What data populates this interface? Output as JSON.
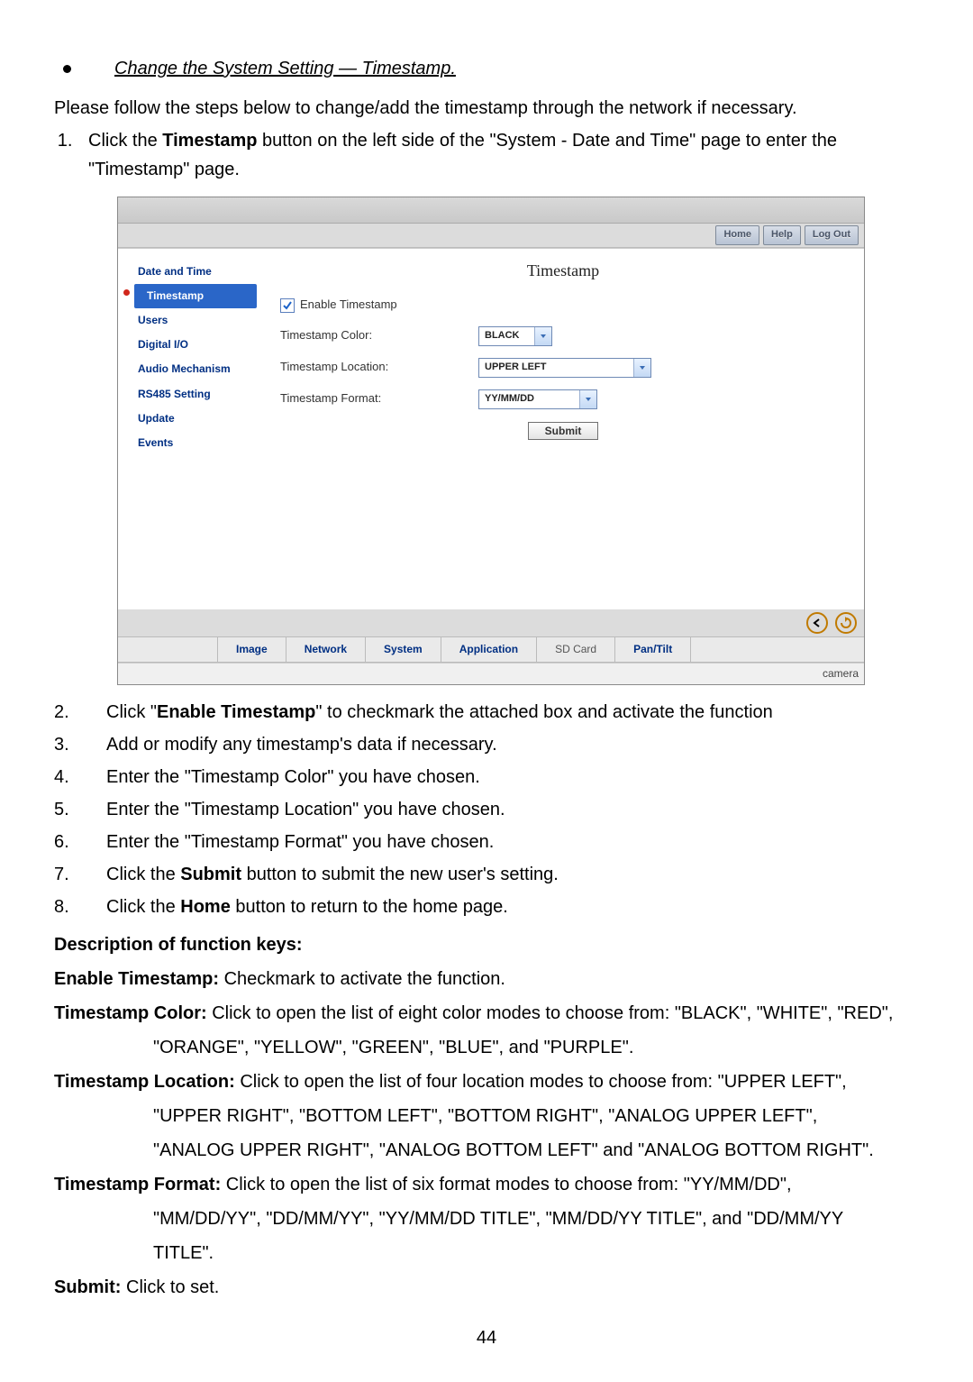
{
  "heading": "Change the System Setting — Timestamp.",
  "intro": "Please follow the steps below to change/add the timestamp through the network if necessary.",
  "step1_prefix": "Click the ",
  "step1_bold": "Timestamp",
  "step1_mid": " button on the left side of the \"System - Date and Time\" page to enter the \"Timestamp\" page.",
  "steps": {
    "2_prefix": "Click \"",
    "2_bold": "Enable Timestamp",
    "2_suffix": "\" to checkmark the attached box and activate the function",
    "3": "Add or modify any timestamp's data if necessary.",
    "4": "Enter the \"Timestamp Color\" you have chosen.",
    "5": "Enter the \"Timestamp Location\" you have chosen.",
    "6": "Enter the \"Timestamp Format\" you have chosen.",
    "7_prefix": "Click the ",
    "7_bold": "Submit",
    "7_suffix": " button to submit the new user's setting.",
    "8_prefix": "Click the ",
    "8_bold": "Home",
    "8_suffix": " button to return to the home page."
  },
  "func_heading": "Description of function keys:",
  "funcs": {
    "enable_k": "Enable Timestamp:",
    "enable_v": " Checkmark to activate the function.",
    "color_k": "Timestamp Color:",
    "color_v": " Click to open the list of eight color modes to choose from: \"BLACK\", \"WHITE\", \"RED\",",
    "color_v2": "\"ORANGE\", \"YELLOW\", \"GREEN\", \"BLUE\", and \"PURPLE\".",
    "loc_k": "Timestamp Location:",
    "loc_v": " Click to open the list of four location modes to choose from: \"UPPER LEFT\",",
    "loc_v2": "\"UPPER RIGHT\", \"BOTTOM LEFT\", \"BOTTOM RIGHT\", \"ANALOG UPPER LEFT\",",
    "loc_v3": "\"ANALOG UPPER RIGHT\", \"ANALOG BOTTOM LEFT\" and \"ANALOG BOTTOM RIGHT\".",
    "fmt_k": "Timestamp Format:",
    "fmt_v": " Click to open the list of six format modes to choose from: \"YY/MM/DD\",",
    "fmt_v2": "\"MM/DD/YY\", \"DD/MM/YY\", \"YY/MM/DD TITLE\", \"MM/DD/YY TITLE\", and \"DD/MM/YY",
    "fmt_v3": "TITLE\".",
    "submit_k": "Submit:",
    "submit_v": " Click to set."
  },
  "page_number": "44",
  "ui": {
    "nav": {
      "home": "Home",
      "help": "Help",
      "logout": "Log Out"
    },
    "sidebar": {
      "date_time": "Date and Time",
      "timestamp": "Timestamp",
      "users": "Users",
      "digital_io": "Digital I/O",
      "audio": "Audio Mechanism",
      "rs485": "RS485 Setting",
      "update": "Update",
      "events": "Events"
    },
    "pane_title": "Timestamp",
    "form": {
      "enable_label": "Enable Timestamp",
      "color_label": "Timestamp Color:",
      "location_label": "Timestamp Location:",
      "format_label": "Timestamp Format:",
      "color_value": "BLACK",
      "location_value": "UPPER LEFT",
      "format_value": "YY/MM/DD",
      "submit": "Submit"
    },
    "tabs": {
      "image": "Image",
      "network": "Network",
      "system": "System",
      "application": "Application",
      "sdcard": "SD Card",
      "pantilt": "Pan/Tilt"
    },
    "footer_label": "camera"
  }
}
